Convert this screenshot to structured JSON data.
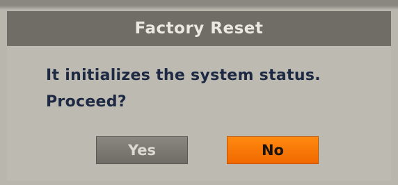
{
  "dialog": {
    "title": "Factory Reset",
    "message_line1": "It initializes the system status.",
    "message_line2": "Proceed?"
  },
  "buttons": {
    "yes_label": "Yes",
    "no_label": "No",
    "focused": "No"
  },
  "colors": {
    "title_bar": "#706d67",
    "dialog_bg": "#bdbab2",
    "message_text": "#1e2a44",
    "yes_button": "#7c7973",
    "no_button_focused": "#f57a08"
  }
}
